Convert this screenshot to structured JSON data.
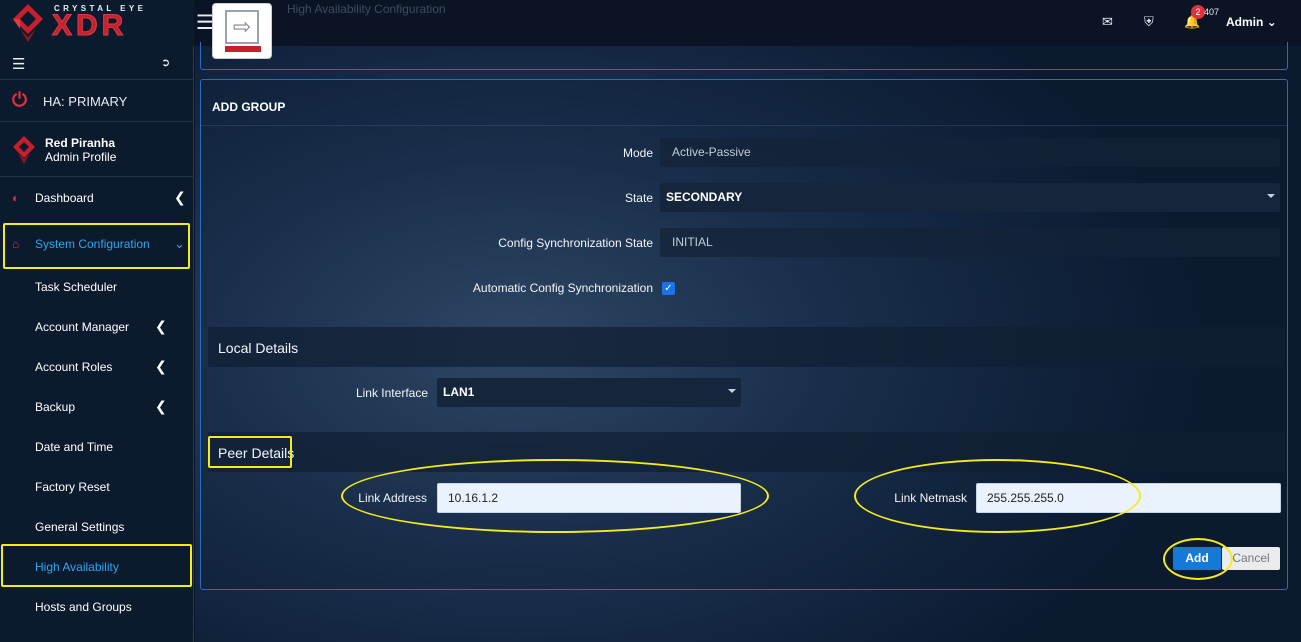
{
  "brand": {
    "tagline": "CRYSTAL EYE",
    "name": "XDR"
  },
  "header": {
    "page_title": "High Availability Configuration",
    "notifications_count": "2",
    "notifications_count_rest": "407",
    "user": "Admin"
  },
  "sidebar": {
    "ha_status": "HA: PRIMARY",
    "profile_name": "Red Piranha",
    "profile_role": "Admin Profile",
    "items": [
      {
        "label": "Dashboard"
      },
      {
        "label": "System Configuration"
      },
      {
        "label": "Task Scheduler"
      },
      {
        "label": "Account Manager"
      },
      {
        "label": "Account Roles"
      },
      {
        "label": "Backup"
      },
      {
        "label": "Date and Time"
      },
      {
        "label": "Factory Reset"
      },
      {
        "label": "General Settings"
      },
      {
        "label": "High Availability"
      },
      {
        "label": "Hosts and Groups"
      }
    ]
  },
  "form": {
    "heading": "ADD GROUP",
    "mode_label": "Mode",
    "mode_value": "Active-Passive",
    "state_label": "State",
    "state_value": "SECONDARY",
    "sync_state_label": "Config Synchronization State",
    "sync_state_value": "INITIAL",
    "auto_sync_label": "Automatic Config Synchronization",
    "auto_sync_checked": true,
    "local_section": "Local Details",
    "link_interface_label": "Link Interface",
    "link_interface_value": "LAN1",
    "peer_section": "Peer Details",
    "link_address_label": "Link Address",
    "link_address_value": "10.16.1.2",
    "link_netmask_label": "Link Netmask",
    "link_netmask_value": "255.255.255.0",
    "add_label": "Add",
    "cancel_label": "Cancel"
  },
  "colors": {
    "accent": "#29a7f0",
    "brand_red": "#c81f2d",
    "highlight": "#f4ea1c",
    "primary_button": "#1479d7"
  }
}
